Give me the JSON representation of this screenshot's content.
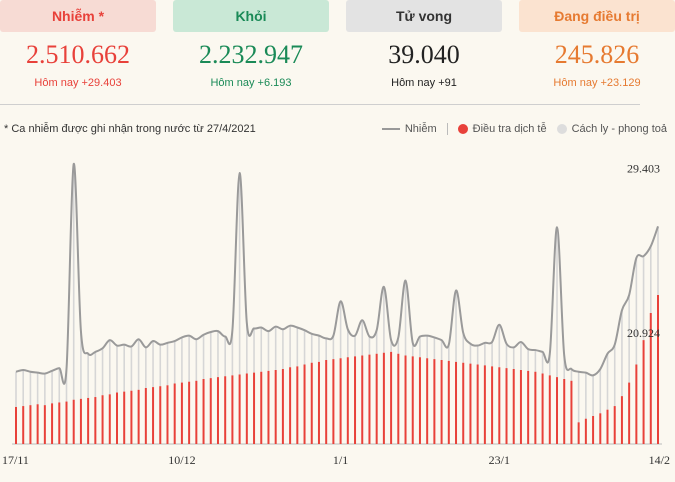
{
  "cards": [
    {
      "label": "Nhiễm *",
      "value": "2.510.662",
      "today": "Hôm nay +29.403",
      "color": "#e8413a"
    },
    {
      "label": "Khỏi",
      "value": "2.232.947",
      "today": "Hôm nay +6.193",
      "color": "#1a8a57"
    },
    {
      "label": "Tử vong",
      "value": "39.040",
      "today": "Hôm nay +91",
      "color": "#222222"
    },
    {
      "label": "Đang điều trị",
      "value": "245.826",
      "today": "Hôm nay +23.129",
      "color": "#e67a31"
    }
  ],
  "note": "* Ca nhiễm được ghi nhận trong nước từ 27/4/2021",
  "legend": [
    {
      "label": "Nhiễm",
      "icon": "line",
      "color": "#999999"
    },
    {
      "label": "Điều tra dịch tễ",
      "icon": "dot",
      "color": "#e8413a"
    },
    {
      "label": "Cách ly - phong toả",
      "icon": "dot",
      "color": "#dddddd"
    }
  ],
  "chart_data": {
    "type": "bar",
    "x_ticks": [
      "17/11",
      "10/12",
      "1/1",
      "23/1",
      "14/2"
    ],
    "x_tick_index": [
      0,
      23,
      45,
      67,
      89
    ],
    "annotations": [
      {
        "text": "29.403",
        "value": 29403
      },
      {
        "text": "20.924",
        "value": 20924
      }
    ],
    "ylim": [
      0,
      32000
    ],
    "total": [
      8000,
      8200,
      8000,
      7900,
      7800,
      8100,
      8400,
      8300,
      31000,
      12500,
      10000,
      10200,
      10600,
      11500,
      10900,
      11000,
      10800,
      11600,
      10700,
      11400,
      11000,
      11200,
      11400,
      11800,
      12000,
      11600,
      12100,
      12400,
      12500,
      11900,
      12600,
      30000,
      13400,
      12800,
      12900,
      12500,
      13000,
      12700,
      13100,
      12900,
      12600,
      12200,
      12000,
      11700,
      12000,
      15800,
      12700,
      12000,
      13700,
      11900,
      12600,
      17400,
      11500,
      11800,
      18100,
      11200,
      11900,
      12000,
      11800,
      11500,
      11000,
      17000,
      12300,
      11100,
      10900,
      11200,
      11300,
      13200,
      11100,
      10700,
      11300,
      10500,
      10400,
      10200,
      10000,
      24000,
      9800,
      8300,
      8000,
      7900,
      7600,
      8300,
      10000,
      11000,
      14800,
      16500,
      20600,
      20800,
      21900,
      24100
    ],
    "epi": [
      4100,
      4200,
      4300,
      4400,
      4300,
      4500,
      4600,
      4700,
      4900,
      5000,
      5100,
      5200,
      5400,
      5500,
      5700,
      5800,
      5900,
      6000,
      6200,
      6300,
      6400,
      6500,
      6700,
      6800,
      6900,
      7000,
      7200,
      7300,
      7400,
      7500,
      7600,
      7700,
      7800,
      7900,
      8000,
      8100,
      8200,
      8300,
      8500,
      8600,
      8800,
      9000,
      9100,
      9300,
      9400,
      9500,
      9600,
      9700,
      9800,
      9900,
      10000,
      10100,
      10200,
      10000,
      9800,
      9700,
      9600,
      9500,
      9400,
      9300,
      9200,
      9100,
      9000,
      8900,
      8800,
      8700,
      8600,
      8500,
      8400,
      8300,
      8200,
      8100,
      8000,
      7800,
      7600,
      7400,
      7200,
      7000,
      2400,
      2800,
      3100,
      3400,
      3800,
      4200,
      5300,
      6800,
      8800,
      11500,
      14500,
      16500
    ]
  }
}
